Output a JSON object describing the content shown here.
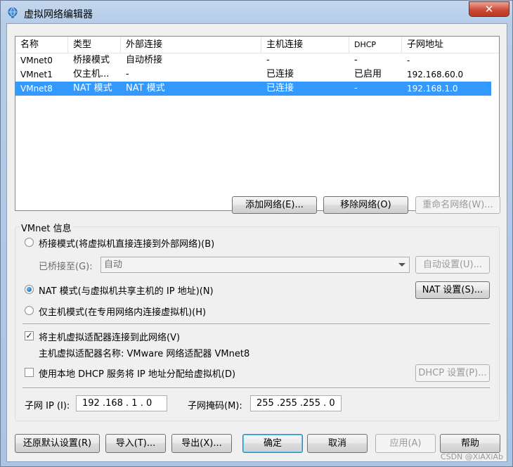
{
  "window": {
    "title": "虚拟网络编辑器",
    "close_label": "✕"
  },
  "networks": {
    "columns": [
      "名称",
      "类型",
      "外部连接",
      "主机连接",
      "DHCP",
      "子网地址"
    ],
    "rows": [
      [
        "VMnet0",
        "桥接模式",
        "自动桥接",
        "-",
        "-",
        "-"
      ],
      [
        "VMnet1",
        "仅主机...",
        "-",
        "已连接",
        "已启用",
        "192.168.60.0"
      ],
      [
        "VMnet8",
        "NAT 模式",
        "NAT 模式",
        "已连接",
        "-",
        "192.168.1.0"
      ]
    ],
    "selected_row": 2
  },
  "list_buttons": {
    "add": "添加网络(E)...",
    "remove": "移除网络(O)",
    "rename": "重命名网络(W)..."
  },
  "vmnet_info": {
    "group_label": "VMnet 信息",
    "bridge_label": "桥接模式(将虚拟机直接连接到外部网络)(B)",
    "bridged_to_label": "已桥接至(G):",
    "bridged_to_value": "自动",
    "auto_settings": "自动设置(U)...",
    "nat_label": "NAT 模式(与虚拟机共享主机的 IP 地址)(N)",
    "nat_settings": "NAT 设置(S)...",
    "hostonly_label": "仅主机模式(在专用网络内连接虚拟机)(H)",
    "connect_adapter_label": "将主机虚拟适配器连接到此网络(V)",
    "connect_adapter_checked": true,
    "adapter_name_text": "主机虚拟适配器名称: VMware 网络适配器 VMnet8",
    "dhcp_label": "使用本地 DHCP 服务将 IP 地址分配给虚拟机(D)",
    "dhcp_checked": false,
    "dhcp_settings": "DHCP 设置(P)...",
    "subnet_ip_label": "子网 IP (I):",
    "subnet_ip_value": "192 .168 . 1  . 0",
    "subnet_mask_label": "子网掩码(M):",
    "subnet_mask_value": "255 .255 .255 . 0",
    "selected_mode": "nat"
  },
  "footer": {
    "restore_defaults": "还原默认设置(R)",
    "import": "导入(T)...",
    "export": "导出(X)...",
    "ok": "确定",
    "cancel": "取消",
    "apply": "应用(A)",
    "help": "帮助"
  },
  "watermark": "CSDN @XiAXiAb",
  "colors": {
    "selection": "#3399ff",
    "close_button": "#cc4b36"
  }
}
